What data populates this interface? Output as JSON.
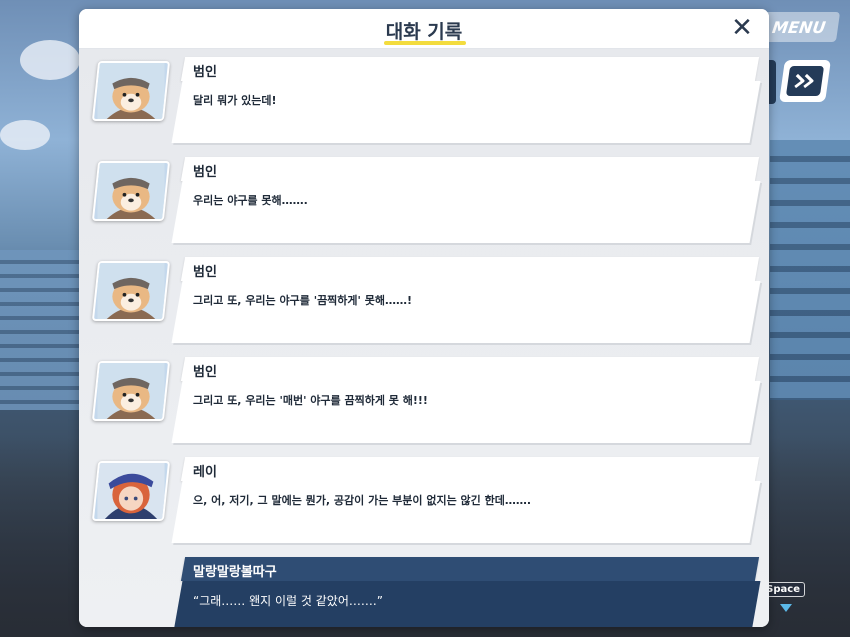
{
  "hud": {
    "menu_label": "MENU",
    "space_label": "Space"
  },
  "panel": {
    "title": "대화 기록",
    "close_symbol": "✕"
  },
  "entries": [
    {
      "speaker": "범인",
      "portrait": "corgi-portrait-icon",
      "text": "달리 뭐가 있는데!"
    },
    {
      "speaker": "범인",
      "portrait": "corgi-portrait-icon",
      "text": "우리는 야구를 못해……."
    },
    {
      "speaker": "범인",
      "portrait": "corgi-portrait-icon",
      "text": "그리고 또, 우리는 야구를 '끔찍하게' 못해……!"
    },
    {
      "speaker": "범인",
      "portrait": "corgi-portrait-icon",
      "text": "그리고 또, 우리는 '매번' 야구를 끔찍하게 못 해!!!"
    },
    {
      "speaker": "레이",
      "portrait": "girl-portrait-icon",
      "text": "으, 어, 저기, 그 말에는 뭔가, 공감이 가는 부분이 없지는 않긴 한데……."
    },
    {
      "speaker": "말랑말랑볼따구",
      "portrait": "",
      "text": "“그래…… 왠지 이럴 것 같았어…….”"
    }
  ],
  "colors": {
    "title_underline": "#f3dc3e",
    "current_name_bar": "#2f4d74",
    "current_msg_box": "#243f63"
  }
}
